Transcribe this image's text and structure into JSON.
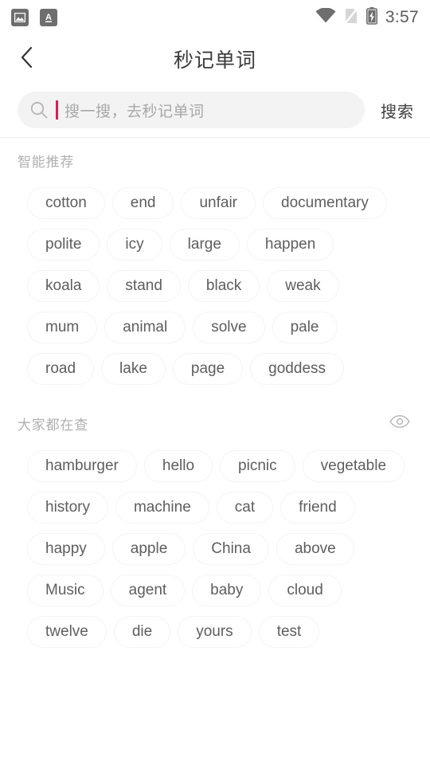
{
  "status_bar": {
    "notifications": [
      "image-icon",
      "translate-icon"
    ],
    "wifi": "wifi-icon",
    "signal": "no-sim-icon",
    "battery": "battery-charging-icon",
    "time": "3:57"
  },
  "nav": {
    "back_icon": "back-chevron-icon",
    "title": "秒记单词"
  },
  "search": {
    "icon": "search-icon",
    "value": "",
    "placeholder": "搜一搜，去秒记单词",
    "caret_color": "#d81b5e",
    "button_label": "搜索"
  },
  "sections": [
    {
      "title": "智能推荐",
      "has_eye": false,
      "tags": [
        "cotton",
        "end",
        "unfair",
        "documentary",
        "polite",
        "icy",
        "large",
        "happen",
        "koala",
        "stand",
        "black",
        "weak",
        "mum",
        "animal",
        "solve",
        "pale",
        "road",
        "lake",
        "page",
        "goddess"
      ]
    },
    {
      "title": "大家都在查",
      "has_eye": true,
      "eye_icon": "eye-icon",
      "tags": [
        "hamburger",
        "hello",
        "picnic",
        "vegetable",
        "history",
        "machine",
        "cat",
        "friend",
        "happy",
        "apple",
        "China",
        "above",
        "Music",
        "agent",
        "baby",
        "cloud",
        "twelve",
        "die",
        "yours",
        "test"
      ]
    }
  ],
  "colors": {
    "background": "#ffffff",
    "chip_border": "#f4f4f4",
    "chip_text": "#5e5e5e",
    "section_title": "#b0b0b0",
    "search_bg": "#f3f3f3",
    "accent": "#d81b5e"
  }
}
